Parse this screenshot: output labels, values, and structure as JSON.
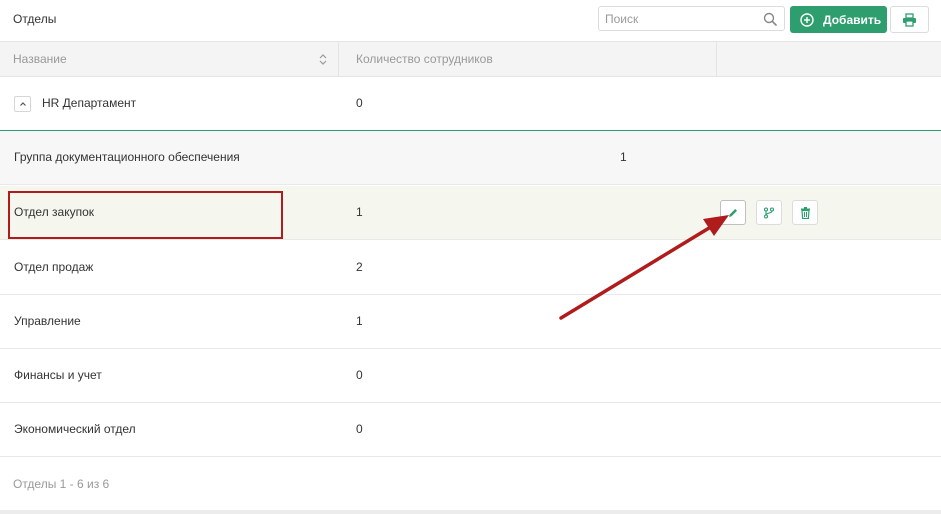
{
  "header": {
    "title": "Отделы",
    "search_placeholder": "Поиск",
    "add_label": "Добавить"
  },
  "table": {
    "columns": [
      "Название",
      "Количество сотрудников",
      ""
    ],
    "group": {
      "name": "HR Департамент",
      "count": "0"
    },
    "rows": [
      {
        "name": "Группа документационного обеспечения",
        "count": "1"
      },
      {
        "name": "Отдел закупок",
        "count": "1"
      },
      {
        "name": "Отдел продаж",
        "count": "2"
      },
      {
        "name": "Управление",
        "count": "1"
      },
      {
        "name": "Финансы и учет",
        "count": "0"
      },
      {
        "name": "Экономический отдел",
        "count": "0"
      }
    ]
  },
  "footer": {
    "pagination": "Отделы 1 - 6 из 6"
  },
  "icons": {
    "search": "search-icon",
    "add": "plus-circle-icon",
    "print": "printer-icon",
    "sort": "sort-icon",
    "collapse": "chevron-up-icon",
    "edit": "pencil-icon",
    "branch": "git-branch-icon",
    "delete": "trash-icon"
  },
  "colors": {
    "accent": "#2e9e6e",
    "highlight_box": "#b01c1c",
    "annotation_arrow": "#b01c1c",
    "selected_row_bg": "#f5f6ed"
  }
}
